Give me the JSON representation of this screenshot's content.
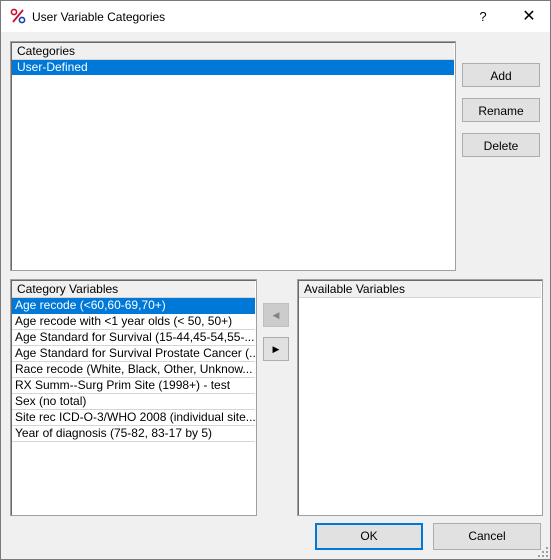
{
  "window": {
    "title": "User Variable Categories",
    "help_label": "?",
    "close_label": "✕",
    "app_icon": "percent-variables-icon"
  },
  "categories_panel": {
    "header": "Categories",
    "items": [
      {
        "label": "User-Defined",
        "selected": true
      }
    ]
  },
  "side_buttons": {
    "add": "Add",
    "rename": "Rename",
    "delete": "Delete"
  },
  "category_variables": {
    "header": "Category Variables",
    "items": [
      {
        "label": "Age recode (<60,60-69,70+)",
        "selected": true
      },
      {
        "label": "Age recode with <1 year olds (< 50, 50+)"
      },
      {
        "label": "Age Standard for Survival (15-44,45-54,55-..."
      },
      {
        "label": "Age Standard for Survival Prostate Cancer (..."
      },
      {
        "label": "Race recode (White, Black, Other, Unknow..."
      },
      {
        "label": "RX Summ--Surg Prim Site (1998+) - test"
      },
      {
        "label": "Sex (no total)"
      },
      {
        "label": "Site rec ICD-O-3/WHO 2008 (individual site..."
      },
      {
        "label": "Year of diagnosis (75-82, 83-17 by 5)"
      }
    ]
  },
  "move_buttons": {
    "left_icon": "left-arrow-icon",
    "right_icon": "right-arrow-icon",
    "left_glyph": "◀",
    "right_glyph": "▶"
  },
  "available_variables": {
    "header": "Available Variables",
    "items": []
  },
  "footer": {
    "ok": "OK",
    "cancel": "Cancel"
  },
  "colors": {
    "selection": "#0078d7",
    "dialog_bg": "#f0f0f0",
    "button_bg": "#e1e1e1"
  }
}
